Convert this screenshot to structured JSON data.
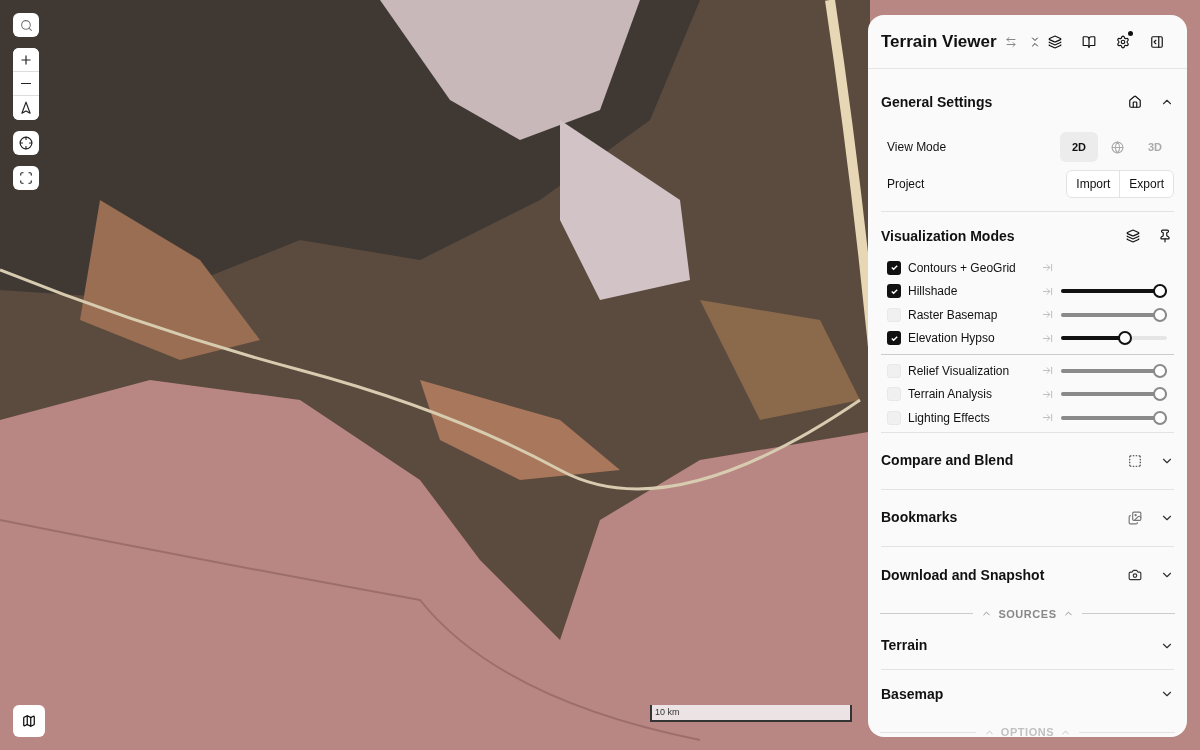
{
  "map": {
    "scale_label": "10 km"
  },
  "panel": {
    "title": "Terrain Viewer",
    "settings_badge": true
  },
  "general_settings": {
    "title": "General Settings",
    "expanded": true,
    "view_mode": {
      "label": "View Mode",
      "options": [
        {
          "kind": "text",
          "label": "2D",
          "selected": true
        },
        {
          "kind": "globe",
          "selected": false
        },
        {
          "kind": "text",
          "label": "3D",
          "selected": false
        }
      ]
    },
    "project": {
      "label": "Project",
      "buttons": [
        "Import",
        "Export"
      ]
    }
  },
  "visualization_modes": {
    "title": "Visualization Modes",
    "groups": [
      [
        {
          "label": "Contours + GeoGrid",
          "checked": true
        },
        {
          "label": "Hillshade",
          "checked": true,
          "level": 1
        },
        {
          "label": "Raster Basemap",
          "checked": false,
          "level": 1
        },
        {
          "label": "Elevation Hypso",
          "checked": true,
          "level": 0.62
        }
      ],
      [
        {
          "label": "Relief Visualization",
          "checked": false,
          "level": 1
        },
        {
          "label": "Terrain Analysis",
          "checked": false,
          "level": 1
        },
        {
          "label": "Lighting Effects",
          "checked": false,
          "level": 1
        }
      ]
    ]
  },
  "sections": [
    {
      "title": "Compare and Blend",
      "kind": "compare",
      "expanded": false
    },
    {
      "title": "Bookmarks",
      "kind": "bookmarks",
      "expanded": false
    },
    {
      "title": "Download and Snapshot",
      "kind": "download",
      "expanded": false
    }
  ],
  "sources_divider": {
    "label": "SOURCES",
    "expanded": true
  },
  "sources": [
    {
      "title": "Terrain",
      "expanded": false
    },
    {
      "title": "Basemap",
      "expanded": false
    }
  ],
  "options_divider": {
    "label": "OPTIONS",
    "expanded": true
  }
}
